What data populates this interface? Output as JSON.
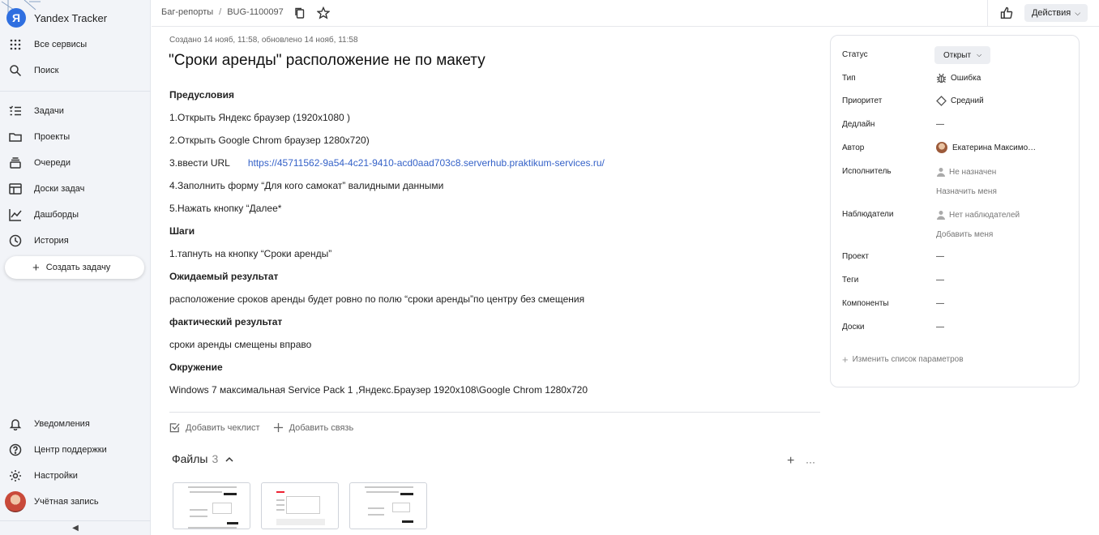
{
  "sidebar": {
    "brand": "Yandex Tracker",
    "top_items": [
      {
        "label": "Все сервисы",
        "icon": "grid-icon"
      },
      {
        "label": "Поиск",
        "icon": "search-icon"
      }
    ],
    "nav_items": [
      {
        "label": "Задачи",
        "icon": "tasks-icon"
      },
      {
        "label": "Проекты",
        "icon": "folder-icon"
      },
      {
        "label": "Очереди",
        "icon": "queues-icon"
      },
      {
        "label": "Доски задач",
        "icon": "board-icon"
      },
      {
        "label": "Дашборды",
        "icon": "chart-icon"
      },
      {
        "label": "История",
        "icon": "history-icon"
      }
    ],
    "create_label": "Создать задачу",
    "bottom_items": [
      {
        "label": "Уведомления",
        "icon": "bell-icon"
      },
      {
        "label": "Центр поддержки",
        "icon": "help-icon"
      },
      {
        "label": "Настройки",
        "icon": "gear-icon"
      },
      {
        "label": "Учётная запись",
        "icon": "avatar"
      }
    ],
    "collapse_glyph": "◀"
  },
  "topbar": {
    "breadcrumb_queue": "Баг-репорты",
    "breadcrumb_sep": "/",
    "breadcrumb_key": "BUG-1100097",
    "actions_label": "Действия"
  },
  "issue": {
    "meta": "Создано 14 нояб, 11:58, обновлено 14 нояб, 11:58",
    "title": "\"Сроки аренды\" расположение не по макету",
    "lines": [
      {
        "text": "Предусловия",
        "bold": true
      },
      {
        "text": "1.Открыть Яндекс браузер (1920х1080 )",
        "bold": false
      },
      {
        "text": "2.Открыть Google Chrom браузер 1280x720)",
        "bold": false
      },
      {
        "text": "3.ввести URL",
        "bold": false,
        "url": "https://45711562-9a54-4c21-9410-acd0aad703c8.serverhub.praktikum-services.ru/"
      },
      {
        "text": "4.Заполнить форму “Для кого самокат” валидными данными",
        "bold": false
      },
      {
        "text": "5.Нажать кнопку “Далее*",
        "bold": false
      },
      {
        "text": "Шаги",
        "bold": true
      },
      {
        "text": "1.тапнуть на кнопку “Сроки аренды”",
        "bold": false
      },
      {
        "text": "Ожидаемый результат",
        "bold": true
      },
      {
        "text": "расположение сроков аренды будет ровно по полю “сроки аренды”по центру без смещения",
        "bold": false
      },
      {
        "text": "фактический результат",
        "bold": true
      },
      {
        "text": "сроки аренды смещены вправо",
        "bold": false
      },
      {
        "text": "Окружение",
        "bold": true
      },
      {
        "text": "Windows 7 максимальная Service Pack 1 ,Яндекс.Браузер 1920x108\\Google Chrom 1280x720",
        "bold": false
      }
    ],
    "add_checklist": "Добавить чеклист",
    "add_link": "Добавить связь",
    "files_label": "Файлы",
    "files_count": "3",
    "files_more": "···"
  },
  "panel": {
    "status_label": "Статус",
    "status_value": "Открыт",
    "type_label": "Тип",
    "type_value": "Ошибка",
    "priority_label": "Приоритет",
    "priority_value": "Средний",
    "deadline_label": "Дедлайн",
    "deadline_value": "—",
    "author_label": "Автор",
    "author_value": "Екатерина Максимо…",
    "assignee_label": "Исполнитель",
    "assignee_value": "Не назначен",
    "assign_me": "Назначить меня",
    "followers_label": "Наблюдатели",
    "followers_value": "Нет наблюдателей",
    "add_me": "Добавить меня",
    "project_label": "Проект",
    "project_value": "—",
    "tags_label": "Теги",
    "tags_value": "—",
    "components_label": "Компоненты",
    "components_value": "—",
    "boards_label": "Доски",
    "boards_value": "—",
    "edit_params": "Изменить список параметров"
  }
}
